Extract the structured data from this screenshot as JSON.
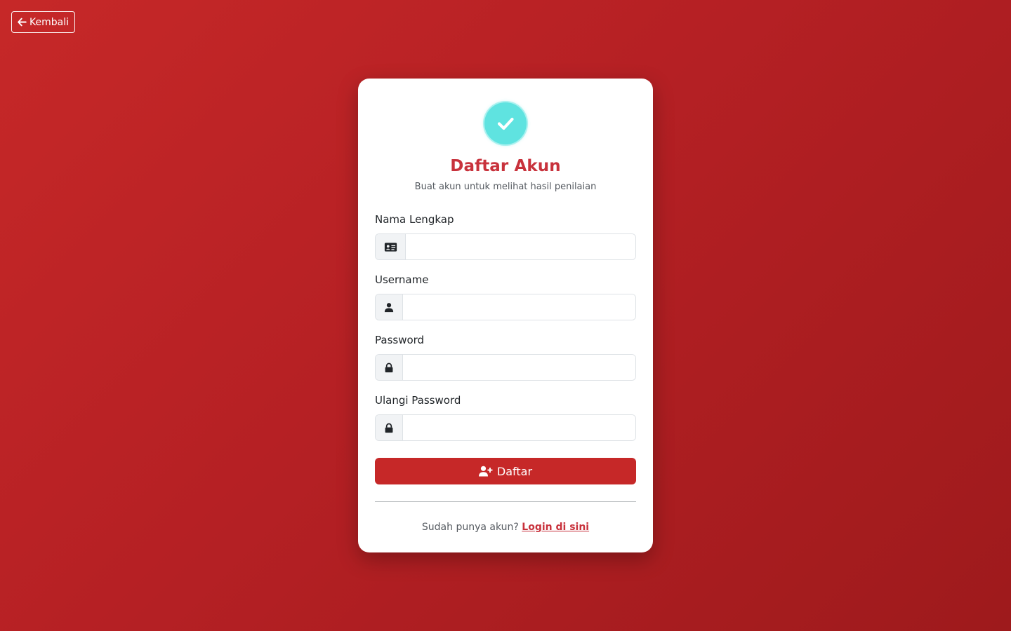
{
  "nav": {
    "back_label": "Kembali",
    "back_icon": "arrow-left-icon"
  },
  "card": {
    "logo_icon": "check-circle-icon",
    "title": "Daftar Akun",
    "subtitle": "Buat akun untuk melihat hasil penilaian"
  },
  "form": {
    "fields": [
      {
        "label": "Nama Lengkap",
        "icon": "id-card-icon",
        "value": "",
        "placeholder": ""
      },
      {
        "label": "Username",
        "icon": "user-icon",
        "value": "",
        "placeholder": ""
      },
      {
        "label": "Password",
        "icon": "lock-icon",
        "value": "",
        "placeholder": ""
      },
      {
        "label": "Ulangi Password",
        "icon": "lock-icon",
        "value": "",
        "placeholder": ""
      }
    ],
    "submit_label": "Daftar",
    "submit_icon": "user-plus-icon"
  },
  "footer": {
    "prompt": "Sudah punya akun?",
    "link_label": "Login di sini"
  },
  "colors": {
    "background": "#c62828",
    "accent": "#c8323c",
    "button": "#c62828",
    "logo_badge": "#5fe3e0"
  }
}
